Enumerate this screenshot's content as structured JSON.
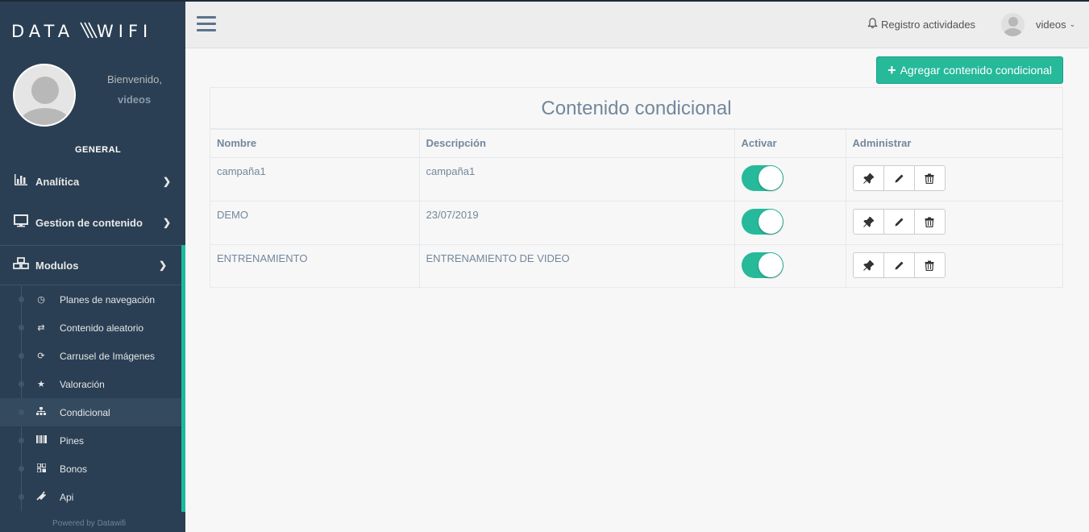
{
  "brand": {
    "logo_text": "DATA\\\\WIFI",
    "accent": "#26b99a",
    "sidebar_bg": "#2a3f54"
  },
  "sidebar": {
    "welcome": "Bienvenido,",
    "username": "videos",
    "section_title": "GENERAL",
    "menu": [
      {
        "label": "Analítica",
        "icon": "bar-chart-icon"
      },
      {
        "label": "Gestion de contenido",
        "icon": "desktop-icon"
      },
      {
        "label": "Modulos",
        "icon": "cubes-icon"
      }
    ],
    "submenu": [
      {
        "label": "Planes de navegación",
        "icon": "clock-icon"
      },
      {
        "label": "Contenido aleatorio",
        "icon": "random-icon"
      },
      {
        "label": "Carrusel de Imágenes",
        "icon": "refresh-icon"
      },
      {
        "label": "Valoración",
        "icon": "star-icon"
      },
      {
        "label": "Condicional",
        "icon": "sitemap-icon"
      },
      {
        "label": "Pines",
        "icon": "barcode-icon"
      },
      {
        "label": "Bonos",
        "icon": "qrcode-icon"
      },
      {
        "label": "Api",
        "icon": "plug-icon"
      }
    ],
    "current_submenu": "Condicional",
    "footer": "Powered by Datawifi"
  },
  "topnav": {
    "activity_label": "Registro actividades",
    "user_label": "videos"
  },
  "main": {
    "add_button_label": "Agregar contenido condicional",
    "panel_title": "Contenido condicional",
    "table": {
      "headers": [
        "Nombre",
        "Descripción",
        "Activar",
        "Administrar"
      ],
      "rows": [
        {
          "nombre": "campaña1",
          "descripcion": "campaña1",
          "activo": true
        },
        {
          "nombre": "DEMO",
          "descripcion": "23/07/2019",
          "activo": true
        },
        {
          "nombre": "ENTRENAMIENTO",
          "descripcion": "ENTRENAMIENTO DE VIDEO",
          "activo": true
        }
      ],
      "actions": [
        "pin-icon",
        "pencil-icon",
        "trash-icon"
      ]
    }
  }
}
